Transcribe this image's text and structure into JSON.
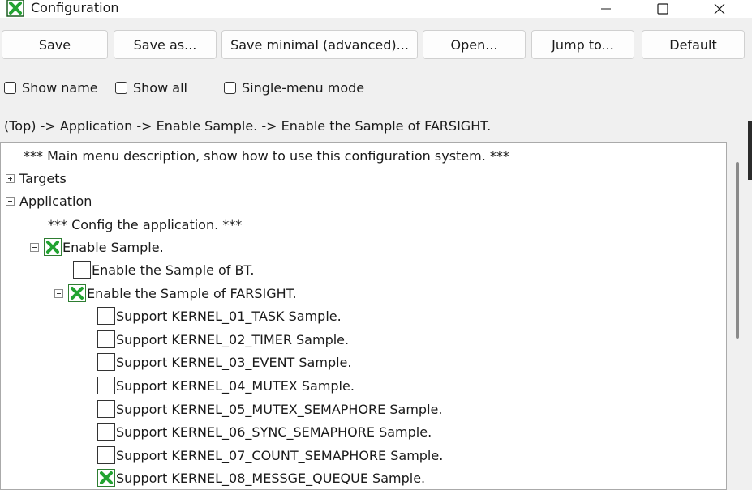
{
  "window": {
    "title": "Configuration",
    "app_icon": "green-x-check-icon",
    "controls": {
      "minimize": "minimize-icon",
      "maximize": "maximize-icon",
      "close": "close-icon"
    }
  },
  "toolbar": {
    "save_label": "Save",
    "save_as_label": "Save as...",
    "save_minimal_label": "Save minimal (advanced)...",
    "open_label": "Open...",
    "jump_to_label": "Jump to...",
    "default_label": "Default"
  },
  "options": {
    "show_name": {
      "label": "Show name",
      "checked": false
    },
    "show_all": {
      "label": "Show all",
      "checked": false
    },
    "single_menu": {
      "label": "Single-menu mode",
      "checked": false
    }
  },
  "breadcrumb": "(Top) -> Application -> Enable Sample. -> Enable the Sample of FARSIGHT.",
  "colors": {
    "check_green": "#22a331",
    "check_green_dark": "#1b5e20"
  },
  "tree": {
    "main_description": "*** Main menu description, show how to use this configuration system. ***",
    "targets_label": "Targets",
    "application_label": "Application",
    "application_desc": "*** Config the application. ***",
    "enable_sample_label": "Enable Sample.",
    "sample_bt_label": "Enable the Sample of BT.",
    "sample_farsight_label": "Enable the Sample of FARSIGHT.",
    "kernel_items": [
      {
        "label": "Support KERNEL_01_TASK Sample.",
        "checked": false
      },
      {
        "label": "Support KERNEL_02_TIMER Sample.",
        "checked": false
      },
      {
        "label": "Support KERNEL_03_EVENT Sample.",
        "checked": false
      },
      {
        "label": "Support KERNEL_04_MUTEX Sample.",
        "checked": false
      },
      {
        "label": "Support KERNEL_05_MUTEX_SEMAPHORE Sample.",
        "checked": false
      },
      {
        "label": "Support KERNEL_06_SYNC_SEMAPHORE Sample.",
        "checked": false
      },
      {
        "label": "Support KERNEL_07_COUNT_SEMAPHORE Sample.",
        "checked": false
      },
      {
        "label": "Support KERNEL_08_MESSGE_QUEQUE Sample.",
        "checked": true
      }
    ]
  }
}
